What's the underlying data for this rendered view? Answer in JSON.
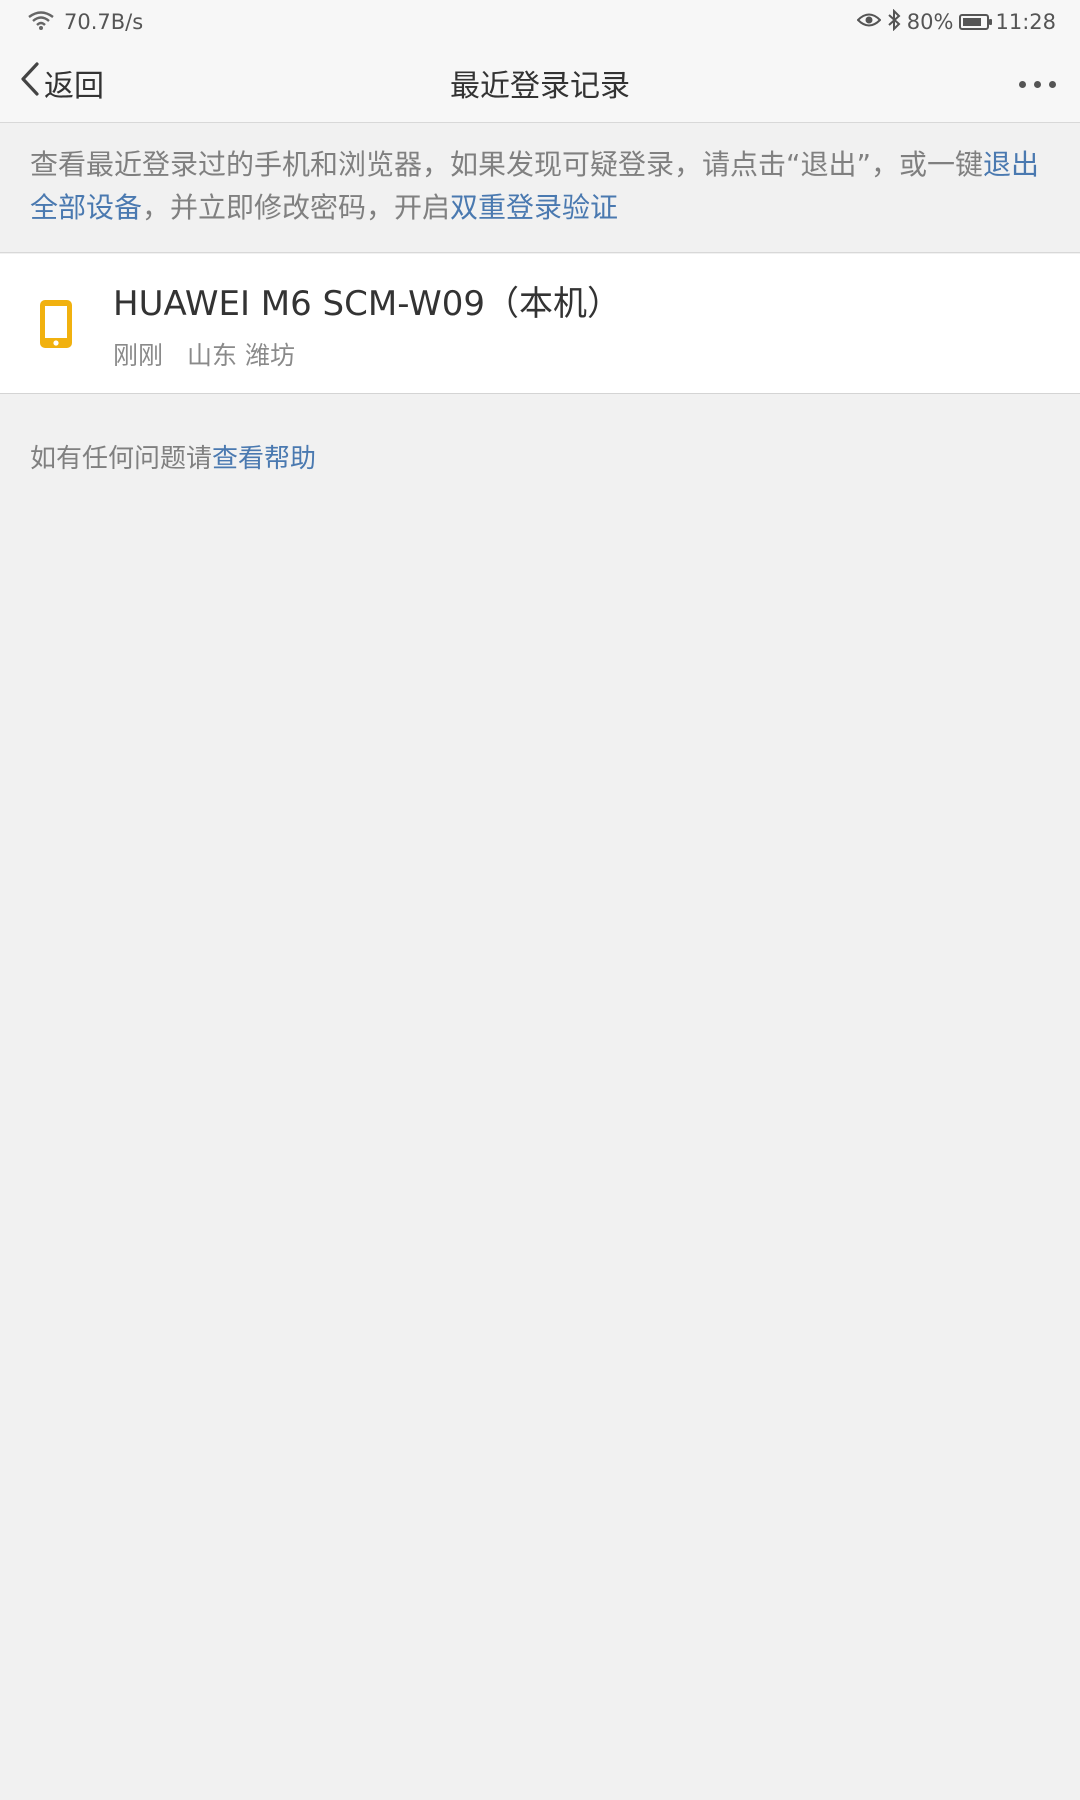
{
  "status_bar": {
    "network_speed": "70.7B/s",
    "battery_percent": "80%",
    "battery_level": 0.8,
    "time": "11:28",
    "icons": [
      "wifi-icon",
      "eye-icon",
      "bluetooth-icon",
      "battery-icon"
    ]
  },
  "nav": {
    "back_label": "返回",
    "title": "最近登录记录"
  },
  "notice": {
    "text_1": "查看最近登录过的手机和浏览器，如果发现可疑登录，请点击“退出”，或一键",
    "link_logout_all": "退出全部设备",
    "text_2": "，并立即修改密码，开启",
    "link_two_step": "双重登录验证"
  },
  "devices": [
    {
      "name": "HUAWEI M6 SCM-W09（本机）",
      "time": "刚刚",
      "location": "山东 潍坊",
      "icon": "phone-icon",
      "icon_color": "#f1b10f"
    }
  ],
  "help": {
    "text": "如有任何问题请",
    "link": "查看帮助"
  },
  "colors": {
    "link": "#4a79b0",
    "background": "#f1f1f1"
  }
}
